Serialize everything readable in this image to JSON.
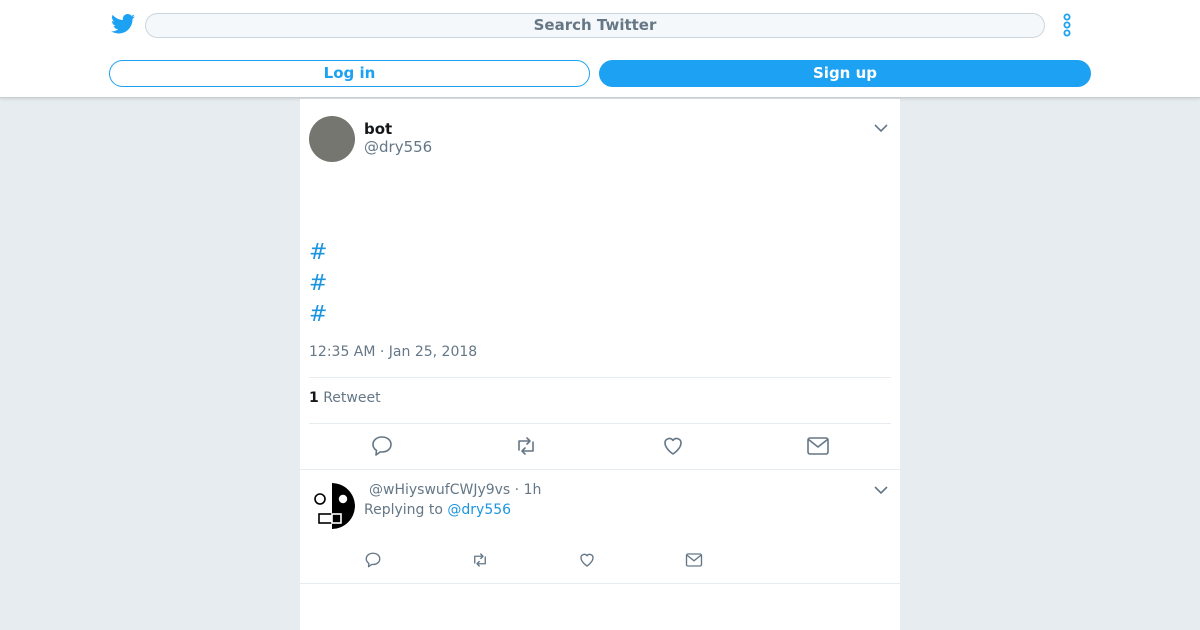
{
  "header": {
    "search_placeholder": "Search Twitter",
    "login_label": "Log in",
    "signup_label": "Sign up"
  },
  "tweet": {
    "display_name": "bot",
    "handle": "@dry556",
    "hashtags": [
      "#",
      "#",
      "#"
    ],
    "timestamp": "12:35 AM · Jan 25, 2018",
    "retweet_count": "1",
    "retweet_label": "Retweet"
  },
  "reply": {
    "meta": "@wHiyswufCWJy9vs · 1h",
    "replying_prefix": "Replying to",
    "replying_handle": "@dry556"
  },
  "colors": {
    "brand": "#1da1f2",
    "link": "#1b95e0",
    "muted": "#657786",
    "background": "#e6ecf0"
  },
  "icons": {
    "logo": "twitter-bird-icon",
    "menu": "more-vertical-icon",
    "caret": "chevron-down-icon",
    "reply": "reply-icon",
    "retweet": "retweet-icon",
    "like": "heart-icon",
    "message": "envelope-icon"
  }
}
